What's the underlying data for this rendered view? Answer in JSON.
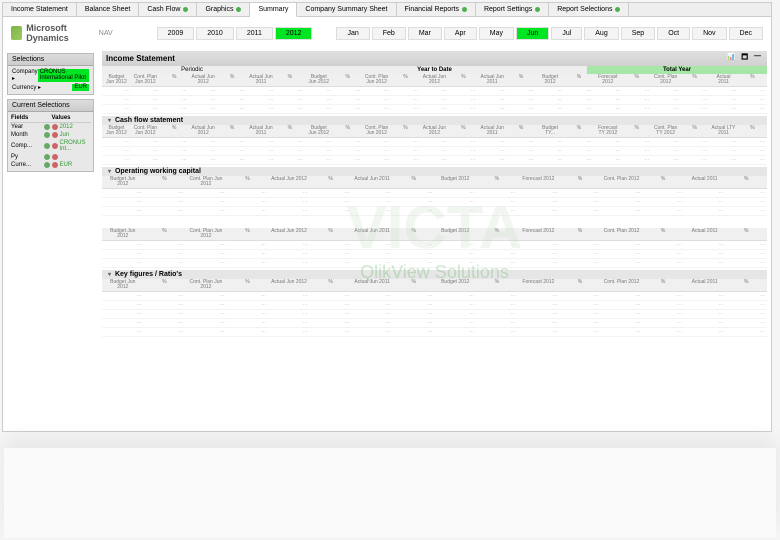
{
  "tabs": [
    "Income Statement",
    "Balance Sheet",
    "Cash Flow",
    "Graphics",
    "Summary",
    "Company Summary Sheet",
    "Financial Reports",
    "Report Settings",
    "Report Selections"
  ],
  "activeTab": 4,
  "logo": "Microsoft Dynamics",
  "logoSuffix": "NAV",
  "years": [
    "2009",
    "2010",
    "2011",
    "2012"
  ],
  "yearSel": "2012",
  "months": [
    "Jan",
    "Feb",
    "Mar",
    "Apr",
    "May",
    "Jun",
    "Jul",
    "Aug",
    "Sep",
    "Oct",
    "Nov",
    "Dec"
  ],
  "monthSel": "Jun",
  "selections": {
    "title": "Selections",
    "rows": [
      {
        "label": "Company",
        "arrow": "▸",
        "value": "CRONUS International Pilot"
      },
      {
        "label": "Currency",
        "arrow": "▸",
        "value": "EUR"
      }
    ]
  },
  "currentSelections": {
    "title": "Current Selections",
    "headers": [
      "Fields",
      "Values"
    ],
    "rows": [
      {
        "field": "Year",
        "value": "2012"
      },
      {
        "field": "Month",
        "value": "Jun"
      },
      {
        "field": "Comp...",
        "value": "CRONUS Int..."
      },
      {
        "field": "Py",
        "value": ""
      },
      {
        "field": "Curre...",
        "value": "EUR"
      }
    ]
  },
  "mainTitle": "Income Statement",
  "periodLabels": {
    "periodic": "Periodic",
    "ytd": "Year to Date",
    "ty": "Total Year"
  },
  "gridHeaders": [
    "Budget Jun 2012",
    "Cont. Plan Jun 2012",
    "%",
    "Actual Jun 2012",
    "%",
    "Actual Jun 2011",
    "%",
    "Budget Jun 2012",
    "%",
    "Cont. Plan Jun 2012",
    "%",
    "Actual Jun 2012",
    "%",
    "Actual Jun 2011",
    "%",
    "Budget 2012",
    "%",
    "Forecast 2012",
    "%",
    "Cont. Plan 2012",
    "%",
    "Actual 2011",
    "%"
  ],
  "sections": {
    "cashFlow": {
      "title": "Cash flow statement",
      "headers": [
        "Budget Jun 2012",
        "Cont. Plan Jun 2012",
        "%",
        "Actual Jun 2012",
        "%",
        "Actual Jun 2011",
        "%",
        "Budget Jun 2012",
        "%",
        "Cont. Plan Jun 2012",
        "%",
        "Actual Jun 2012",
        "%",
        "Actual Jun 2011",
        "%",
        "Budget TY...",
        "%",
        "Forecast TY 2012",
        "%",
        "Cont. Plan TY 2012",
        "%",
        "Actual LTY 2011",
        "%"
      ]
    },
    "owc": {
      "title": "Operating working capital",
      "headers": [
        "Budget Jun 2012",
        "%",
        "Cont. Plan Jun 2012",
        "%",
        "Actual Jun 2012",
        "%",
        "Actual Jun 2011",
        "%",
        "Budget 2012",
        "%",
        "Forecast 2012",
        "%",
        "Cont. Plan 2012",
        "%",
        "Actual 2011",
        "%"
      ]
    },
    "keyFigures": {
      "title": "Key figures / Ratio's",
      "headers": [
        "Budget Jun 2012",
        "%",
        "Cont. Plan Jun 2012",
        "%",
        "Actual Jun 2012",
        "%",
        "Actual Jun 2011",
        "%",
        "Budget 2012",
        "%",
        "Forecast 2012",
        "%",
        "Cont. Plan 2012",
        "%",
        "Actual 2011",
        "%"
      ]
    }
  },
  "watermark": {
    "main": "VICTA",
    "sub": "QlikView Solutions"
  },
  "icons": {
    "chart": "📊",
    "expand": "🗖",
    "min": "—",
    "collapse": "▾"
  }
}
